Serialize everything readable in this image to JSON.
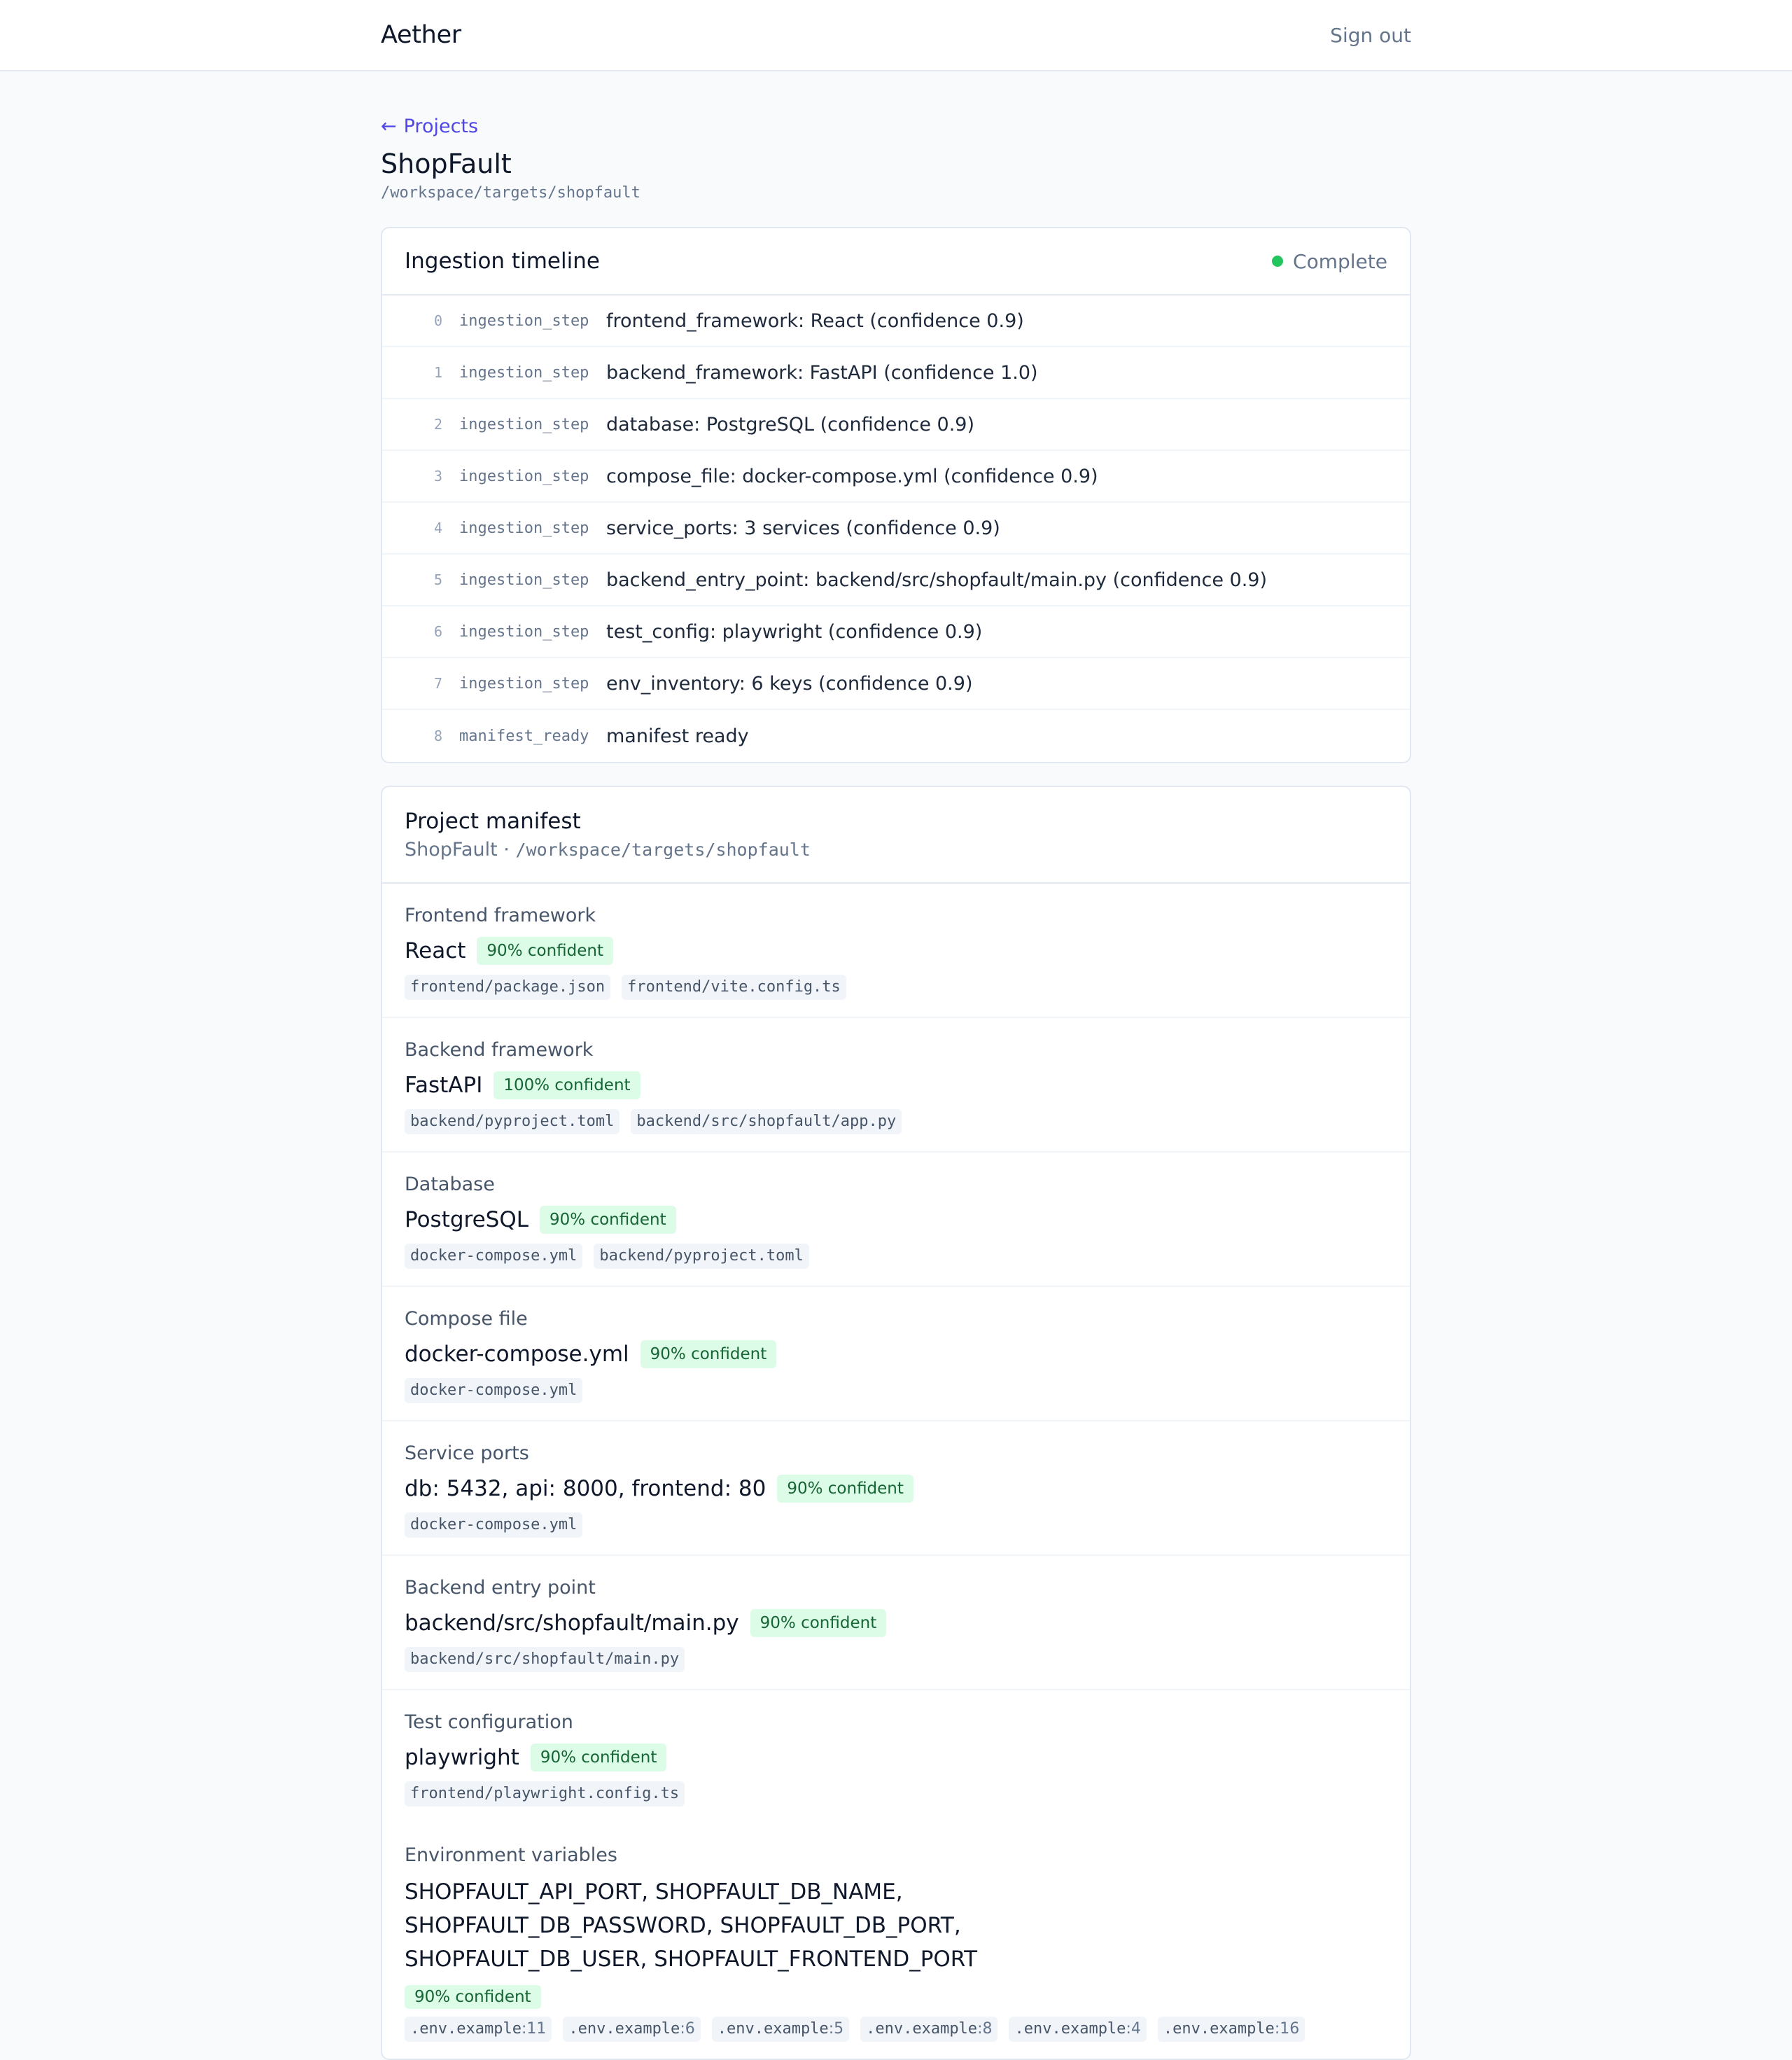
{
  "app": {
    "brand": "Aether",
    "signout_label": "Sign out"
  },
  "breadcrumb": {
    "arrow": "←",
    "label": "Projects"
  },
  "project": {
    "name": "ShopFault",
    "path": "/workspace/targets/shopfault"
  },
  "timeline": {
    "title": "Ingestion timeline",
    "status": "Complete",
    "status_color": "#22c55e",
    "rows": [
      {
        "index": "0",
        "type": "ingestion_step",
        "text": "frontend_framework: React (confidence 0.9)"
      },
      {
        "index": "1",
        "type": "ingestion_step",
        "text": "backend_framework: FastAPI (confidence 1.0)"
      },
      {
        "index": "2",
        "type": "ingestion_step",
        "text": "database: PostgreSQL (confidence 0.9)"
      },
      {
        "index": "3",
        "type": "ingestion_step",
        "text": "compose_file: docker-compose.yml (confidence 0.9)"
      },
      {
        "index": "4",
        "type": "ingestion_step",
        "text": "service_ports: 3 services (confidence 0.9)"
      },
      {
        "index": "5",
        "type": "ingestion_step",
        "text": "backend_entry_point: backend/src/shopfault/main.py (confidence 0.9)"
      },
      {
        "index": "6",
        "type": "ingestion_step",
        "text": "test_config: playwright (confidence 0.9)"
      },
      {
        "index": "7",
        "type": "ingestion_step",
        "text": "env_inventory: 6 keys (confidence 0.9)"
      },
      {
        "index": "8",
        "type": "manifest_ready",
        "text": "manifest ready"
      }
    ]
  },
  "manifest": {
    "title": "Project manifest",
    "subtitle_name": "ShopFault",
    "subtitle_sep": " · ",
    "subtitle_path": "/workspace/targets/shopfault",
    "sections": [
      {
        "label": "Frontend framework",
        "value": "React",
        "badge": "90% confident",
        "files": [
          {
            "path": "frontend/package.json"
          },
          {
            "path": "frontend/vite.config.ts"
          }
        ]
      },
      {
        "label": "Backend framework",
        "value": "FastAPI",
        "badge": "100% confident",
        "files": [
          {
            "path": "backend/pyproject.toml"
          },
          {
            "path": "backend/src/shopfault/app.py"
          }
        ]
      },
      {
        "label": "Database",
        "value": "PostgreSQL",
        "badge": "90% confident",
        "files": [
          {
            "path": "docker-compose.yml"
          },
          {
            "path": "backend/pyproject.toml"
          }
        ]
      },
      {
        "label": "Compose file",
        "value": "docker-compose.yml",
        "badge": "90% confident",
        "files": [
          {
            "path": "docker-compose.yml"
          }
        ]
      },
      {
        "label": "Service ports",
        "value": "db: 5432, api: 8000, frontend: 80",
        "badge": "90% confident",
        "files": [
          {
            "path": "docker-compose.yml"
          }
        ]
      },
      {
        "label": "Backend entry point",
        "value": "backend/src/shopfault/main.py",
        "badge": "90% confident",
        "files": [
          {
            "path": "backend/src/shopfault/main.py"
          }
        ]
      },
      {
        "label": "Test configuration",
        "value": "playwright",
        "badge": "90% confident",
        "files": [
          {
            "path": "frontend/playwright.config.ts"
          }
        ]
      }
    ],
    "env": {
      "label": "Environment variables",
      "value": "SHOPFAULT_API_PORT, SHOPFAULT_DB_NAME, SHOPFAULT_DB_PASSWORD, SHOPFAULT_DB_PORT, SHOPFAULT_DB_USER, SHOPFAULT_FRONTEND_PORT",
      "badge": "90% confident",
      "files": [
        {
          "path": ".env.example",
          "line": ":11"
        },
        {
          "path": ".env.example",
          "line": ":6"
        },
        {
          "path": ".env.example",
          "line": ":5"
        },
        {
          "path": ".env.example",
          "line": ":8"
        },
        {
          "path": ".env.example",
          "line": ":4"
        },
        {
          "path": ".env.example",
          "line": ":16"
        }
      ]
    }
  }
}
